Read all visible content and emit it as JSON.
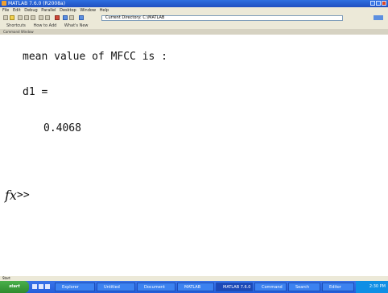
{
  "window": {
    "title": "MATLAB 7.6.0 (R2008a)"
  },
  "menu": [
    "File",
    "Edit",
    "Debug",
    "Parallel",
    "Desktop",
    "Window",
    "Help"
  ],
  "toolbar": {
    "current_directory": "Current Directory: C:\\MATLAB"
  },
  "shortcuts": [
    "Shortcuts",
    "How to Add",
    "What's New"
  ],
  "command_window": {
    "header": "Command Window",
    "lines": [
      "mean value of MFCC is :",
      "d1 =",
      "0.4068"
    ],
    "fx_symbol": "fx",
    "prompt": ">>"
  },
  "status": {
    "text": "Start"
  },
  "taskbar": {
    "start_label": "start",
    "tasks": [
      "Explorer",
      "Untitled",
      "Document",
      "MATLAB",
      "MATLAB 7.6.0",
      "Command",
      "Search",
      "Editor"
    ],
    "tray_time": "2:30 PM"
  }
}
